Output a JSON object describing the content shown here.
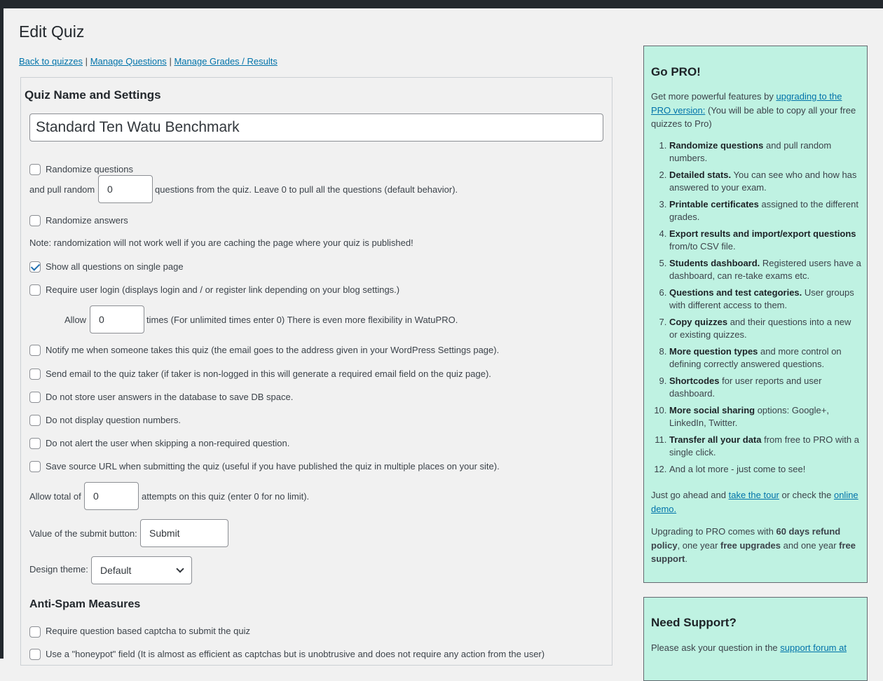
{
  "page": {
    "title": "Edit Quiz"
  },
  "nav": {
    "back": "Back to quizzes",
    "sep1": "|",
    "manage_questions": "Manage Questions",
    "sep2": "|",
    "manage_grades": "Manage Grades / Results"
  },
  "settings": {
    "title": "Quiz Name and Settings",
    "quiz_name": "Standard Ten Watu Benchmark",
    "randomize_questions": {
      "label": "Randomize questions",
      "checked": false
    },
    "pull_random": {
      "before": "and pull random",
      "value": "0",
      "after": "questions from the quiz. Leave 0 to pull all the questions (default behavior)."
    },
    "randomize_answers": {
      "label": "Randomize answers",
      "checked": false
    },
    "note": "Note: randomization will not work well if you are caching the page where your quiz is published!",
    "single_page": {
      "label": "Show all questions on single page",
      "checked": true
    },
    "require_login": {
      "label": "Require user login (displays login and / or register link depending on your blog settings.)",
      "checked": false
    },
    "allow_times": {
      "before": "Allow",
      "value": "0",
      "after": "times (For unlimited times enter 0) There is even more flexibility in WatuPRO."
    },
    "notify_me": {
      "label": "Notify me when someone takes this quiz (the email goes to the address given in your WordPress Settings page).",
      "checked": false
    },
    "send_email": {
      "label": "Send email to the quiz taker (if taker is non-logged in this will generate a required email field on the quiz page).",
      "checked": false
    },
    "no_store": {
      "label": "Do not store user answers in the database to save DB space.",
      "checked": false
    },
    "no_numbers": {
      "label": "Do not display question numbers.",
      "checked": false
    },
    "no_alert": {
      "label": "Do not alert the user when skipping a non-required question.",
      "checked": false
    },
    "save_url": {
      "label": "Save source URL when submitting the quiz (useful if you have published the quiz in multiple places on your site).",
      "checked": false
    },
    "attempts": {
      "before": "Allow total of",
      "value": "0",
      "after": "attempts on this quiz (enter 0 for no limit)."
    },
    "submit_value": {
      "label": "Value of the submit button:",
      "value": "Submit"
    },
    "design_theme": {
      "label": "Design theme:",
      "selected": "Default"
    }
  },
  "antispam": {
    "title": "Anti-Spam Measures",
    "captcha": {
      "label": "Require question based captcha to submit the quiz",
      "checked": false
    },
    "honeypot": {
      "label": "Use a \"honeypot\" field (It is almost as efficient as captchas but is unobtrusive and does not require any action from the user)",
      "checked": false
    }
  },
  "pro": {
    "title": "Go PRO!",
    "intro_before": "Get more powerful features by",
    "intro_link": "upgrading to the PRO version:",
    "intro_after": "(You will be able to copy all your free quizzes to Pro)",
    "features": [
      {
        "bold": "Randomize questions",
        "rest": " and pull random numbers."
      },
      {
        "bold": "Detailed stats.",
        "rest": " You can see who and how has answered to your exam."
      },
      {
        "bold": "Printable certificates",
        "rest": " assigned to the different grades."
      },
      {
        "bold": "Export results and import/export questions",
        "rest": " from/to CSV file."
      },
      {
        "bold": "Students dashboard.",
        "rest": " Registered users have a dashboard, can re-take exams etc."
      },
      {
        "bold": "Questions and test categories.",
        "rest": " User groups with different access to them."
      },
      {
        "bold": "Copy quizzes",
        "rest": " and their questions into a new or existing quizzes."
      },
      {
        "bold": "More question types",
        "rest": " and more control on defining correctly answered questions."
      },
      {
        "bold": "Shortcodes",
        "rest": " for user reports and user dashboard."
      },
      {
        "bold": "More social sharing",
        "rest": " options: Google+, LinkedIn, Twitter."
      },
      {
        "bold": "Transfer all your data",
        "rest": " from free to PRO with a single click."
      },
      {
        "bold": "",
        "rest": "And a lot more - just come to see!"
      }
    ],
    "tour_before": "Just go ahead and",
    "tour_link": "take the tour",
    "tour_mid": "or check the",
    "demo_link": "online demo.",
    "refund_a": "Upgrading to PRO comes with",
    "refund_b": "60 days refund policy",
    "refund_c": ", one year",
    "refund_d": "free upgrades",
    "refund_e": "and one year",
    "refund_f": "free support",
    "refund_g": "."
  },
  "support": {
    "title": "Need Support?",
    "text_before": "Please ask your question in the",
    "link": "support forum at"
  }
}
